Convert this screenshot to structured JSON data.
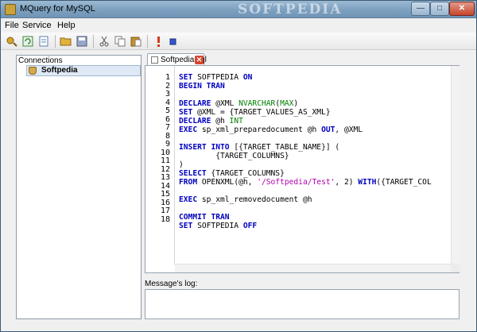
{
  "window": {
    "title": "MQuery for MySQL",
    "watermark": "SOFTPEDIA",
    "controls": {
      "minimize": "—",
      "maximize": "□",
      "close": "✕"
    }
  },
  "menu": [
    {
      "label": "File"
    },
    {
      "label": "Service"
    },
    {
      "label": "Help"
    }
  ],
  "toolbar": {
    "buttons": [
      {
        "icon": "new-connection-icon",
        "color": "#d9a52b"
      },
      {
        "icon": "refresh-icon",
        "color": "#3a8a3a"
      },
      {
        "icon": "new-query-icon",
        "color": "#5a7fb0"
      },
      {
        "icon": "open-folder-icon",
        "color": "#e2b23c"
      },
      {
        "icon": "save-icon",
        "color": "#6a78a8"
      },
      {
        "icon": "cut-icon",
        "color": "#666666"
      },
      {
        "icon": "copy-icon",
        "color": "#7a7a7a"
      },
      {
        "icon": "paste-icon",
        "color": "#c8922e"
      },
      {
        "icon": "execute-icon",
        "color": "#d23b1c"
      },
      {
        "icon": "stop-icon",
        "color": "#3355cc"
      }
    ]
  },
  "connections": {
    "header": "Connections",
    "items": [
      {
        "label": "Softpedia"
      }
    ]
  },
  "tab": {
    "label": "Softpedia.sql"
  },
  "editor": {
    "line_numbers": [
      "1",
      "2",
      "3",
      "4",
      "5",
      "6",
      "7",
      "8",
      "9",
      "10",
      "11",
      "12",
      "13",
      "14",
      "15",
      "16",
      "17",
      "18"
    ],
    "code_lines": [
      "SET SOFTPEDIA ON",
      "BEGIN TRAN",
      "",
      "DECLARE @XML NVARCHAR(MAX)",
      "SET @XML = {TARGET_VALUES_AS_XML}",
      "DECLARE @h INT",
      "EXEC sp_xml_preparedocument @h OUT, @XML",
      "",
      "INSERT INTO [{TARGET_TABLE_NAME}] (",
      "        {TARGET_COLUMNS}",
      ")",
      "SELECT {TARGET_COLUMNS}",
      "FROM OPENXML(@h, '/Softpedia/Test', 2) WITH({TARGET_COL",
      "",
      "EXEC sp_xml_removedocument @h",
      "",
      "COMMIT TRAN",
      "SET SOFTPEDIA OFF"
    ]
  },
  "log": {
    "label": "Message's log:",
    "content": ""
  },
  "colors": {
    "keyword": "#0000c0",
    "type": "#008000",
    "string": "#b000b0",
    "titlebar": "#7fa2c1",
    "selection": "#dfe9f5"
  }
}
